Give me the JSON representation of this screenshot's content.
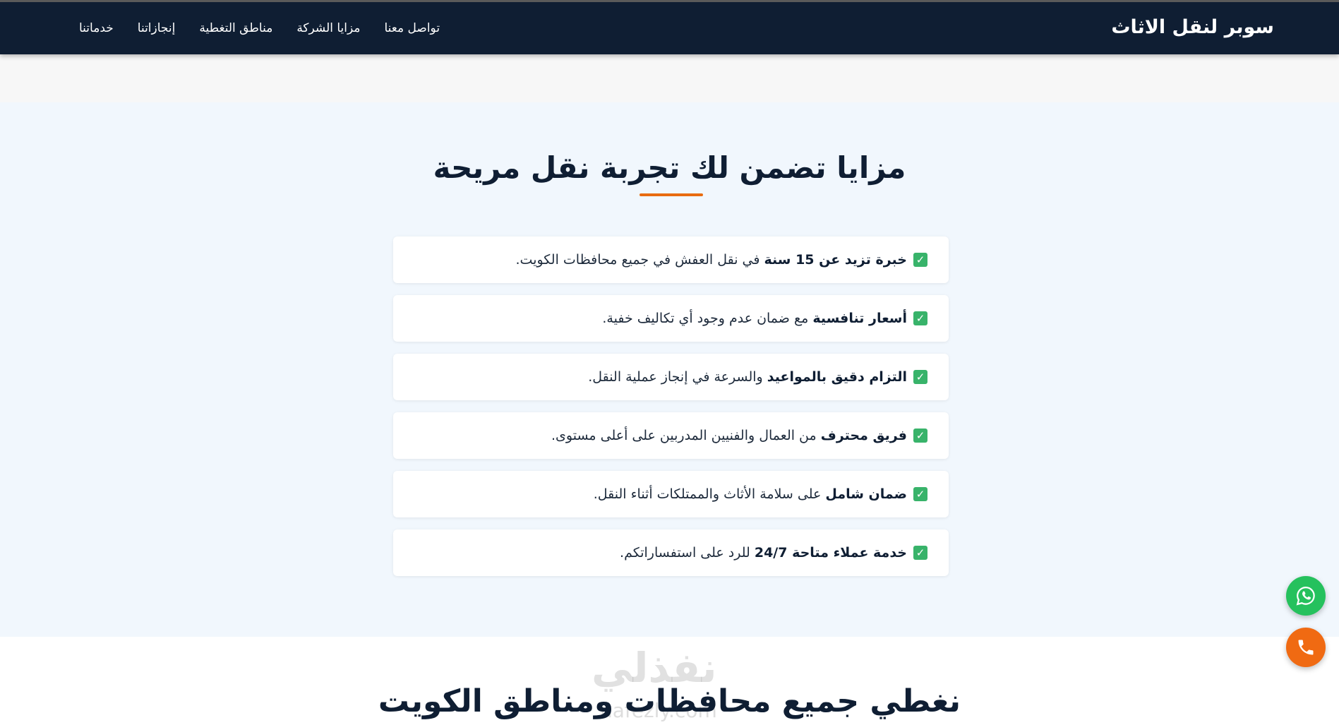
{
  "header": {
    "brand": "سوبر لنقل الاثاث",
    "nav": [
      {
        "label": "خدماتنا"
      },
      {
        "label": "إنجازاتنا"
      },
      {
        "label": "مناطق التغطية"
      },
      {
        "label": "مزايا الشركة"
      },
      {
        "label": "تواصل معنا"
      }
    ]
  },
  "features": {
    "title": "مزايا تضمن لك تجربة نقل مريحة",
    "items": [
      {
        "bold": "خبرة تزيد عن 15 سنة",
        "rest": " في نقل العفش في جميع محافظات الكويت."
      },
      {
        "bold": "أسعار تنافسية",
        "rest": " مع ضمان عدم وجود أي تكاليف خفية."
      },
      {
        "bold": "التزام دقيق بالمواعيد",
        "rest": " والسرعة في إنجاز عملية النقل."
      },
      {
        "bold": "فريق محترف",
        "rest": " من العمال والفنيين المدربين على أعلى مستوى."
      },
      {
        "bold": "ضمان شامل",
        "rest": " على سلامة الأثاث والممتلكات أثناء النقل."
      },
      {
        "bold": "خدمة عملاء متاحة 24/7",
        "rest": " للرد على استفساراتكم."
      }
    ],
    "check_icon": "check-box-icon",
    "check_glyph": "✓"
  },
  "coverage": {
    "title": "نغطي جميع محافظات ومناطق الكويت"
  },
  "watermark": {
    "text": "نفذلي",
    "url": "nafezly.com"
  },
  "floating": {
    "whatsapp_icon": "whatsapp-icon",
    "phone_icon": "phone-icon"
  },
  "colors": {
    "header_bg": "#0f1e33",
    "accent": "#e86c10",
    "check": "#38b36a",
    "whatsapp": "#25c15d",
    "phone": "#f06a12"
  }
}
